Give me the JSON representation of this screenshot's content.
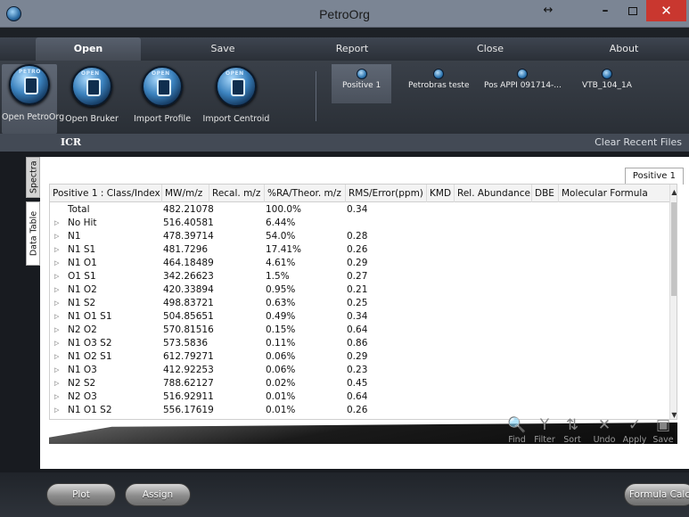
{
  "window": {
    "title": "PetroOrg",
    "resize_glyph": "↔",
    "minimize_glyph": "–",
    "close_glyph": "✕"
  },
  "menu": {
    "tabs": [
      "Open",
      "Save",
      "Report",
      "Close",
      "About"
    ],
    "active": "Open"
  },
  "ribbon": {
    "tools": [
      {
        "label": "Open PetroOrg",
        "icon": "petroorg-icon",
        "tag": "PETRO"
      },
      {
        "label": "Open Bruker",
        "icon": "open-bruker-icon",
        "tag": "OPEN"
      },
      {
        "label": "Import Profile",
        "icon": "import-profile-icon",
        "tag": "OPEN"
      },
      {
        "label": "Import Centroid",
        "icon": "import-centroid-icon",
        "tag": "OPEN"
      }
    ],
    "recent_files": [
      "Positive 1",
      "Petrobras teste",
      "Pos APPI 091714-...",
      "VTB_104_1A"
    ]
  },
  "section": {
    "title": "ICR",
    "clear_recent": "Clear Recent Files"
  },
  "side_tabs": [
    "Spectra",
    "Data Table"
  ],
  "panel": {
    "sub_tab": "Positive 1"
  },
  "table": {
    "columns": [
      "Positive 1 : Class/Index",
      "MW/m/z",
      "Recal. m/z",
      "%RA/Theor. m/z",
      "RMS/Error(ppm)",
      "KMD",
      "Rel. Abundance",
      "DBE",
      "Molecular Formula"
    ],
    "rows": [
      {
        "name": "Total",
        "mw": "482.21078",
        "ra": "100.0%",
        "rms": "0.34",
        "expandable": false
      },
      {
        "name": "No Hit",
        "mw": "516.40581",
        "ra": "6.44%",
        "rms": "",
        "expandable": true
      },
      {
        "name": "N1",
        "mw": "478.39714",
        "ra": "54.0%",
        "rms": "0.28",
        "expandable": true
      },
      {
        "name": "N1 S1",
        "mw": "481.7296",
        "ra": "17.41%",
        "rms": "0.26",
        "expandable": true
      },
      {
        "name": "N1 O1",
        "mw": "464.18489",
        "ra": "4.61%",
        "rms": "0.29",
        "expandable": true
      },
      {
        "name": "O1 S1",
        "mw": "342.26623",
        "ra": "1.5%",
        "rms": "0.27",
        "expandable": true
      },
      {
        "name": "N1 O2",
        "mw": "420.33894",
        "ra": "0.95%",
        "rms": "0.21",
        "expandable": true
      },
      {
        "name": "N1 S2",
        "mw": "498.83721",
        "ra": "0.63%",
        "rms": "0.25",
        "expandable": true
      },
      {
        "name": "N1 O1 S1",
        "mw": "504.85651",
        "ra": "0.49%",
        "rms": "0.34",
        "expandable": true
      },
      {
        "name": "N2 O2",
        "mw": "570.81516",
        "ra": "0.15%",
        "rms": "0.64",
        "expandable": true
      },
      {
        "name": "N1 O3 S2",
        "mw": "573.5836",
        "ra": "0.11%",
        "rms": "0.86",
        "expandable": true
      },
      {
        "name": "N1 O2 S1",
        "mw": "612.79271",
        "ra": "0.06%",
        "rms": "0.29",
        "expandable": true
      },
      {
        "name": "N1 O3",
        "mw": "412.92253",
        "ra": "0.06%",
        "rms": "0.23",
        "expandable": true
      },
      {
        "name": "N2 S2",
        "mw": "788.62127",
        "ra": "0.02%",
        "rms": "0.45",
        "expandable": true
      },
      {
        "name": "N2 O3",
        "mw": "516.92911",
        "ra": "0.01%",
        "rms": "0.64",
        "expandable": true
      },
      {
        "name": "N1 O1 S2",
        "mw": "556.17619",
        "ra": "0.01%",
        "rms": "0.26",
        "expandable": true
      }
    ],
    "scroll_up": "▲",
    "scroll_down": "▼"
  },
  "table_toolbar": [
    {
      "label": "Find",
      "icon": "find-icon",
      "glyph": "🔍"
    },
    {
      "label": "Filter",
      "icon": "filter-icon",
      "glyph": "Y"
    },
    {
      "label": "Sort",
      "icon": "sort-icon",
      "glyph": "⇅"
    },
    {
      "label": "Undo",
      "icon": "undo-icon",
      "glyph": "✕"
    },
    {
      "label": "Apply",
      "icon": "apply-icon",
      "glyph": "✓"
    },
    {
      "label": "Save",
      "icon": "save-icon",
      "glyph": "▣"
    }
  ],
  "bottom_buttons": [
    "Plot",
    "Assign",
    "Formula Calc"
  ],
  "colors": {
    "titlebar": "#7b8594",
    "close_button": "#c9372f",
    "accent_disc": "#3b82be"
  }
}
